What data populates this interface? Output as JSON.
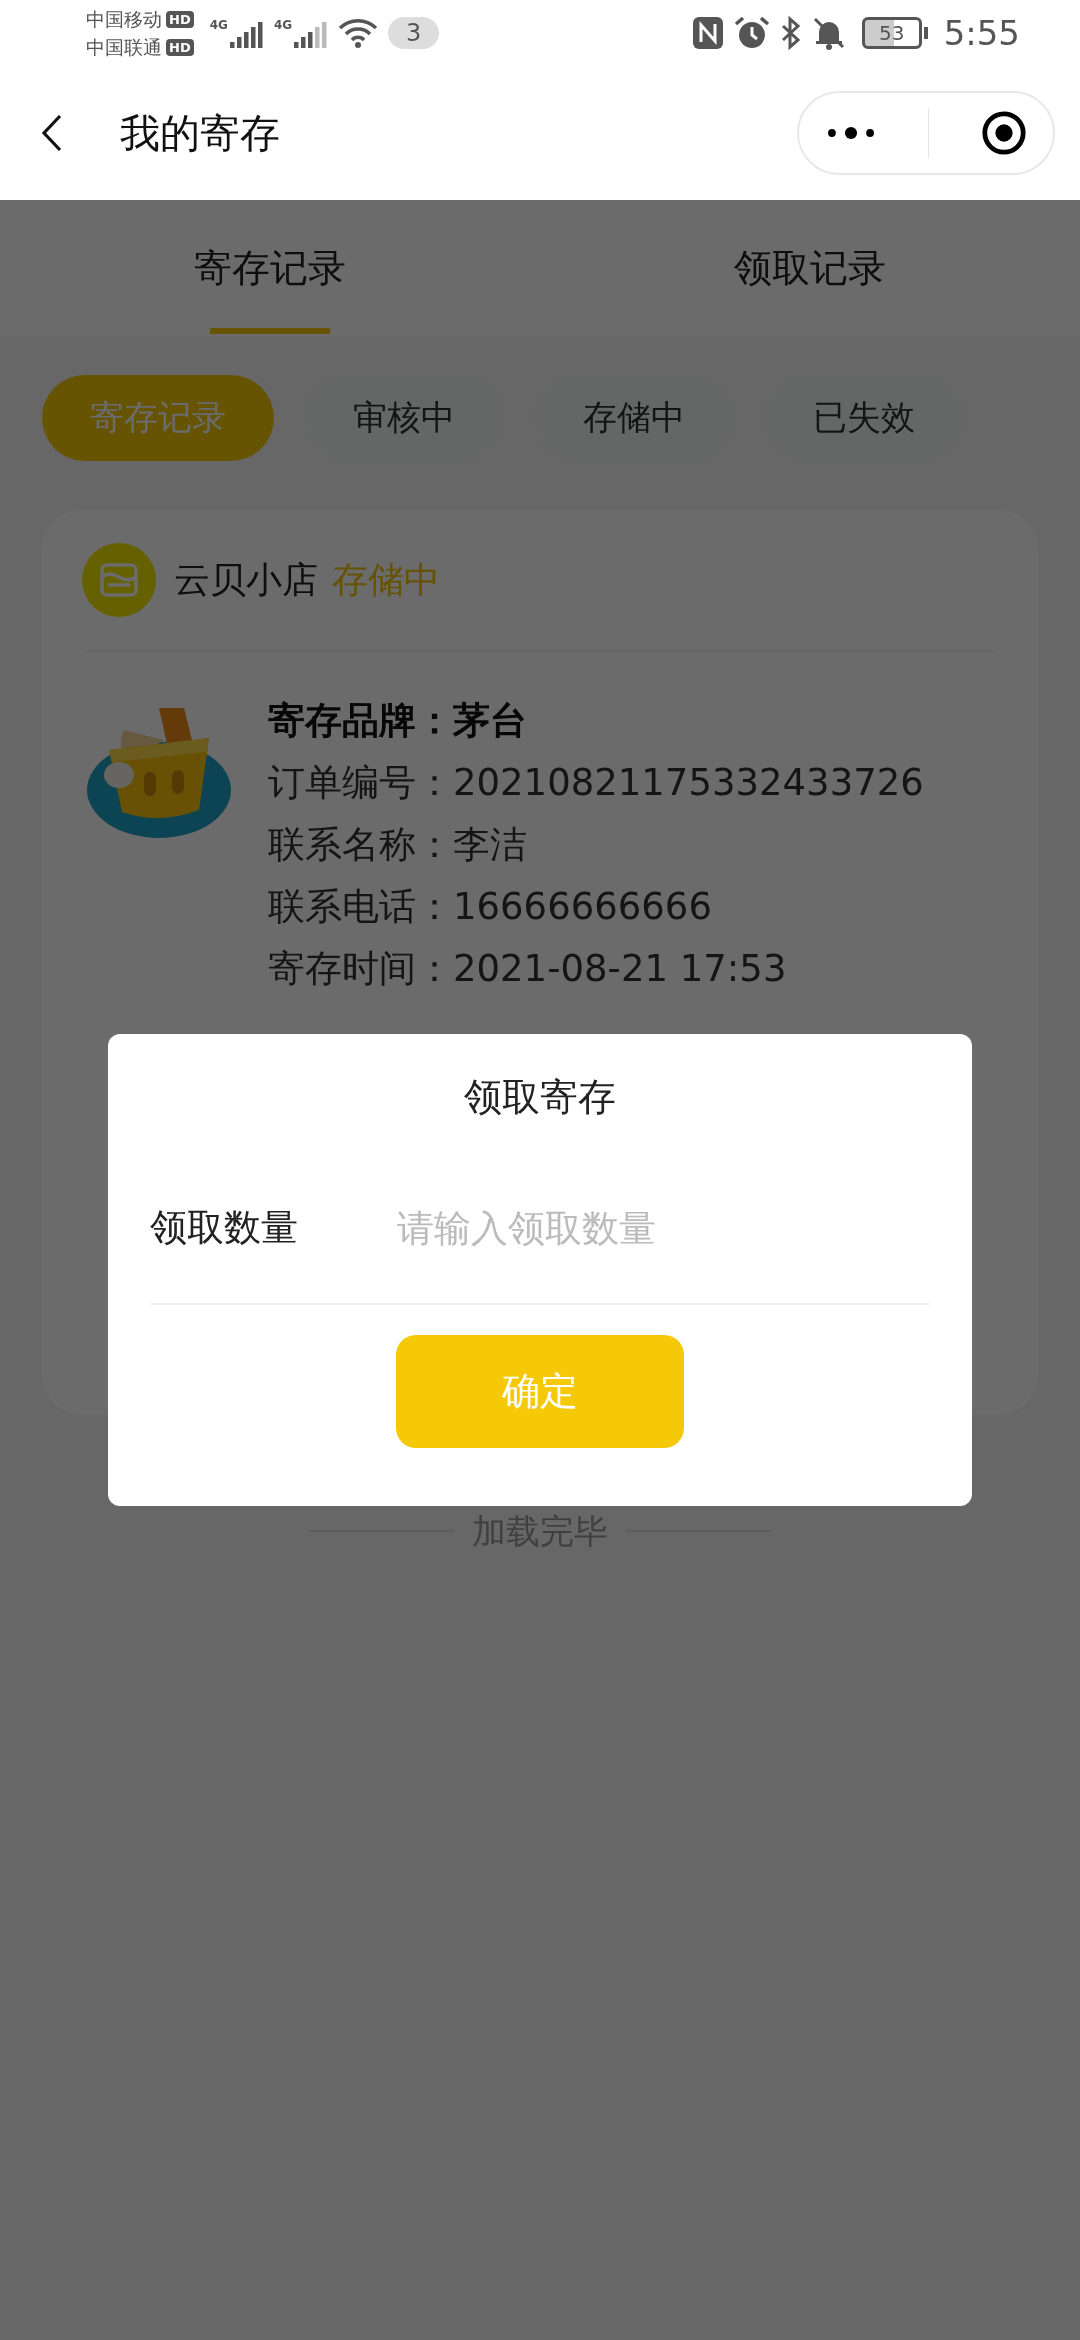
{
  "status_bar": {
    "carriers": [
      {
        "name": "中国移动",
        "badge": "HD"
      },
      {
        "name": "中国联通",
        "badge": "HD"
      }
    ],
    "signals": [
      {
        "label": "4G"
      },
      {
        "label": "4G"
      }
    ],
    "notification_count": "3",
    "battery": "53",
    "time": "5:55"
  },
  "nav": {
    "title": "我的寄存"
  },
  "tabs": [
    {
      "label": "寄存记录",
      "selected": true
    },
    {
      "label": "领取记录",
      "selected": false
    }
  ],
  "filters": [
    {
      "label": "寄存记录",
      "selected": true
    },
    {
      "label": "审核中",
      "selected": false
    },
    {
      "label": "存储中",
      "selected": false
    },
    {
      "label": "已失效",
      "selected": false
    }
  ],
  "record": {
    "shop": "云贝小店",
    "status": "存储中",
    "fields": [
      {
        "label": "寄存品牌：",
        "value": "茅台",
        "emphasis": true
      },
      {
        "label": "订单编号：",
        "value": "20210821175332433726",
        "emphasis": false
      },
      {
        "label": "联系名称：",
        "value": "李洁",
        "emphasis": false
      },
      {
        "label": "联系电话：",
        "value": "16666666666",
        "emphasis": false
      },
      {
        "label": "寄存时间：",
        "value": "2021-08-21 17:53",
        "emphasis": false
      }
    ]
  },
  "footer": {
    "text": "加载完毕"
  },
  "dialog": {
    "title": "领取寄存",
    "field_label": "领取数量",
    "placeholder": "请输入领取数量",
    "confirm": "确定"
  }
}
